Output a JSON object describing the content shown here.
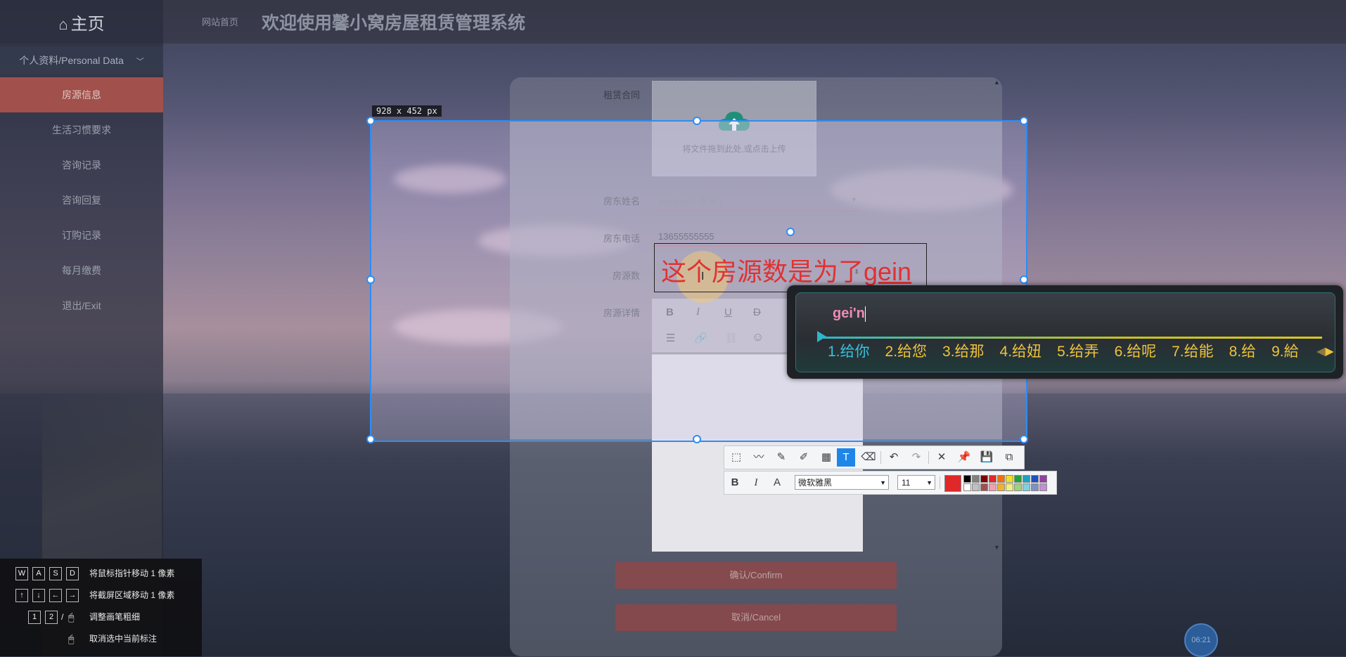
{
  "app": {
    "home_label": "主页",
    "breadcrumb": "网站首页",
    "title": "欢迎使用馨小窝房屋租赁管理系统"
  },
  "sidebar": {
    "group_label": "个人资料/Personal Data",
    "items": [
      {
        "label": "房源信息"
      },
      {
        "label": "生活习惯要求"
      },
      {
        "label": "咨询记录"
      },
      {
        "label": "咨询回复"
      },
      {
        "label": "订购记录"
      },
      {
        "label": "每月缴费"
      },
      {
        "label": "退出/Exit"
      }
    ]
  },
  "form": {
    "contract_label": "租赁合同",
    "upload_hint": "将文件拖到此处,或点击上传",
    "landlord_name_label": "房东姓名",
    "landlord_name_value": "yonghu2--房东1",
    "landlord_phone_label": "房东电话",
    "landlord_phone_value": "13655555555",
    "house_count_label": "房源数",
    "house_detail_label": "房源详情",
    "confirm_label": "确认/Confirm",
    "cancel_label": "取消/Cancel"
  },
  "capture": {
    "size_label": "928 x 452  px",
    "annotation_text_main": "这个房源数是为了",
    "annotation_text_pending": "gein"
  },
  "ime": {
    "composition": "gei'n",
    "candidates": [
      "1.给你",
      "2.给您",
      "3.给那",
      "4.给妞",
      "5.给弄",
      "6.给呢",
      "7.给能",
      "8.给",
      "9.給"
    ]
  },
  "text_toolbar": {
    "font_name": "微软雅黑",
    "font_size": "11",
    "current_color": "#e02828",
    "palette_top": [
      "#000000",
      "#808080",
      "#800000",
      "#e02828",
      "#f07010",
      "#f0e020",
      "#20a040",
      "#20a0c0",
      "#2050c0",
      "#9040a0"
    ],
    "palette_bottom": [
      "#ffffff",
      "#c0c0c0",
      "#a05050",
      "#f0a0b0",
      "#f0b030",
      "#f0f080",
      "#a0d080",
      "#80d0e0",
      "#8090c0",
      "#c090d0"
    ]
  },
  "hints": [
    {
      "keys": [
        "W",
        "A",
        "S",
        "D"
      ],
      "text": "将鼠标指针移动 1 像素"
    },
    {
      "keys": [
        "↑",
        "↓",
        "←",
        "→"
      ],
      "text": "将截屏区域移动 1 像素"
    },
    {
      "keys": [
        "1",
        "2"
      ],
      "text": "调整画笔粗细"
    },
    {
      "keys": [],
      "text": "取消选中当前标注"
    }
  ],
  "timer": "06:21"
}
